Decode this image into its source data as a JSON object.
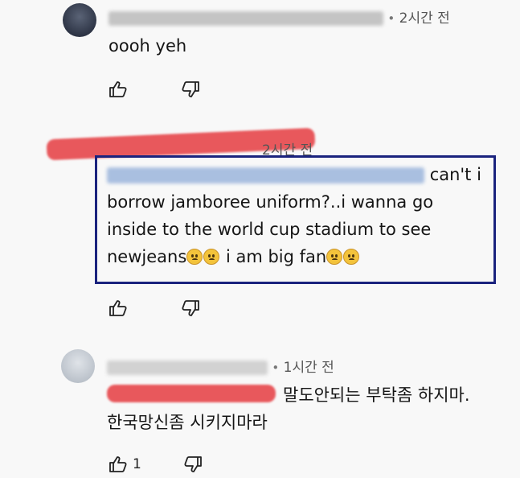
{
  "comments": [
    {
      "time": "2시간 전",
      "separator": "•",
      "text": "oooh yeh",
      "like_count": ""
    },
    {
      "time": "2시간 전",
      "text_lines": [
        "can't i",
        "borrow jamboree uniform?..i wanna go",
        "inside to the world cup stadium to see",
        "newjeans",
        "i am big fan"
      ],
      "like_count": ""
    },
    {
      "time": "1시간 전",
      "separator": "•",
      "text_lines": [
        "말도안되는 부탁좀 하지마.",
        "한국망신좀 시키지마라"
      ],
      "like_count": "1"
    }
  ],
  "icons": {
    "like": "thumbs-up-icon",
    "dislike": "thumbs-down-icon",
    "emoji": "sad-face-emoji"
  },
  "colors": {
    "highlight_border": "#1a237e",
    "redaction": "#e8585c",
    "mention_blur": "#a9bfe0"
  }
}
